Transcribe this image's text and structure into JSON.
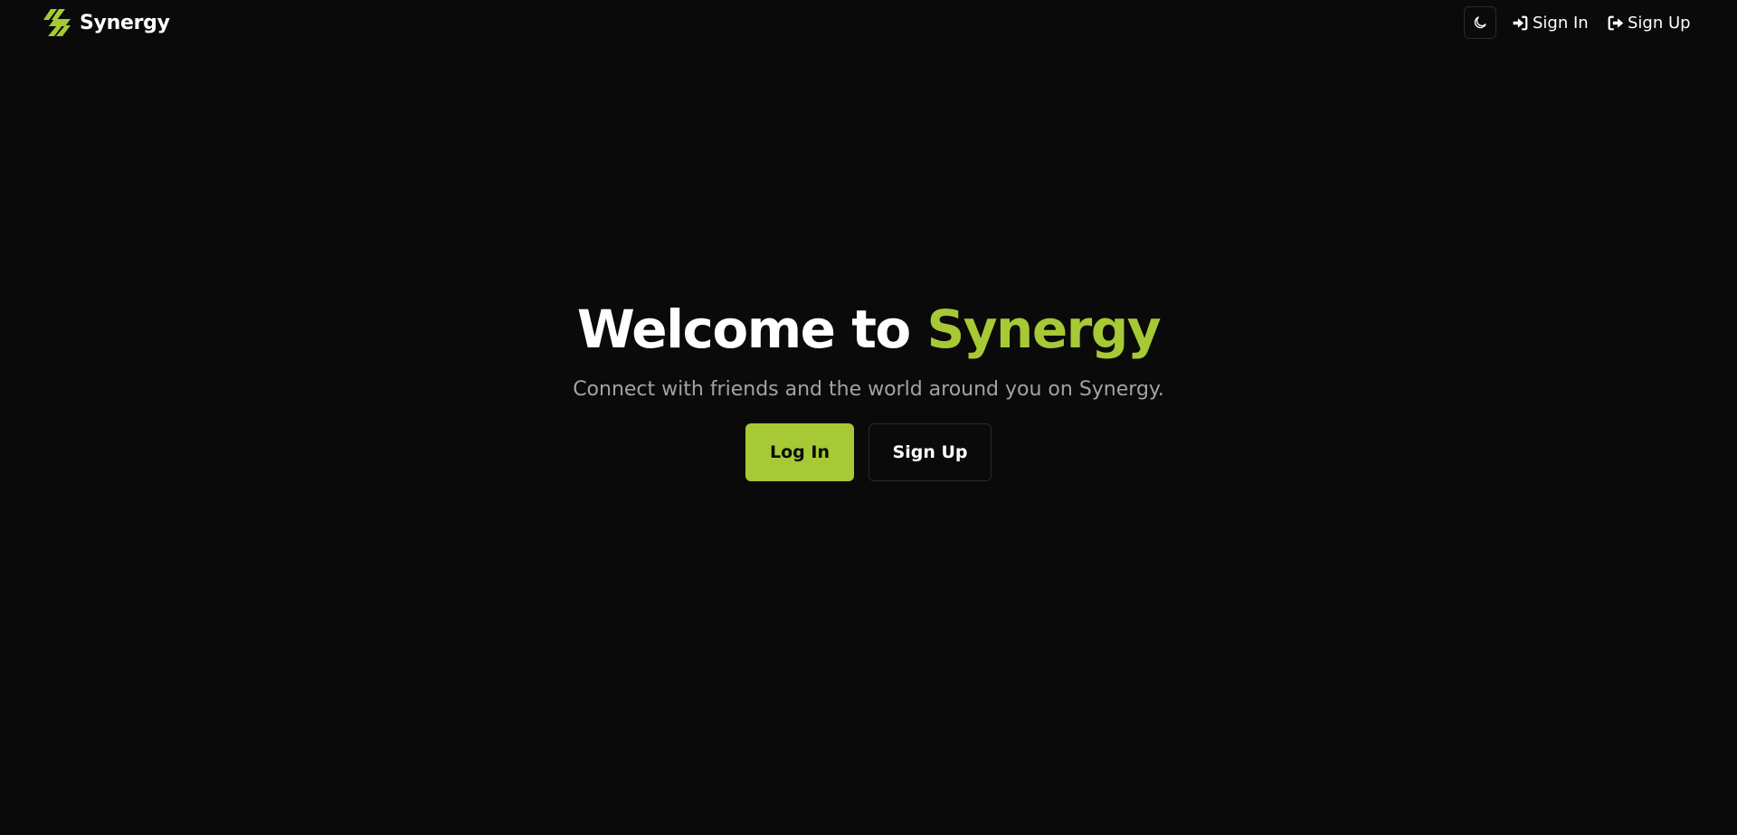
{
  "header": {
    "brand_name": "Synergy",
    "brand_icon": "synergy-logo-icon",
    "theme_toggle_icon": "moon-icon",
    "nav": [
      {
        "label": "Sign In",
        "icon": "sign-in-icon"
      },
      {
        "label": "Sign Up",
        "icon": "sign-out-icon"
      }
    ]
  },
  "hero": {
    "title_prefix": "Welcome to ",
    "title_accent": "Synergy",
    "subtitle": "Connect with friends and the world around you on Synergy.",
    "login_label": "Log In",
    "signup_label": "Sign Up"
  },
  "colors": {
    "background": "#0a0a0a",
    "accent": "#a6c935",
    "text": "#ffffff",
    "muted_text": "#a3a3a3",
    "border": "#2a2a2a"
  }
}
